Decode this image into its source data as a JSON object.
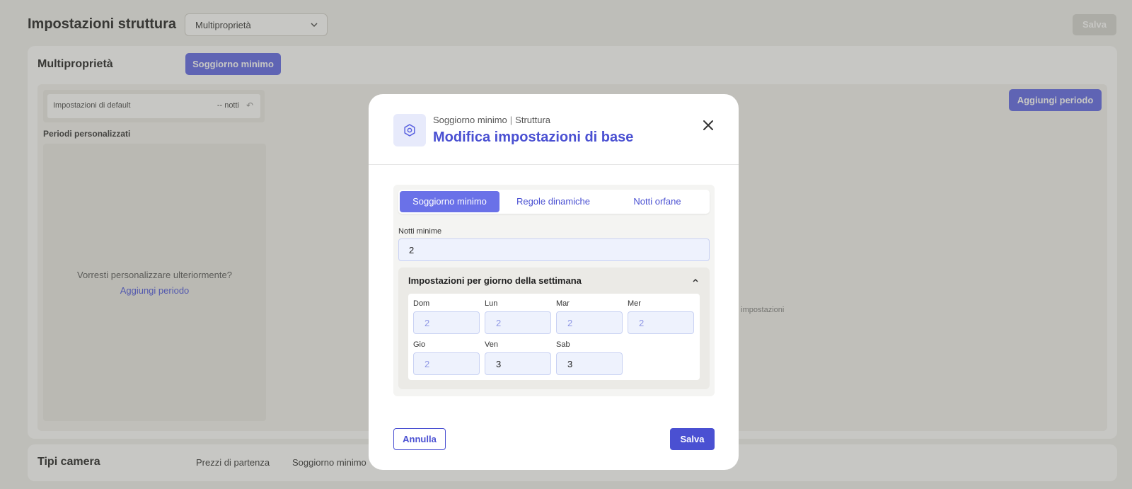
{
  "page": {
    "title": "Impostazioni struttura",
    "property_select_value": "Multiproprietà",
    "save_label": "Salva"
  },
  "main_card": {
    "title": "Multiproprietà",
    "tab_label": "Soggiorno minimo",
    "default_settings_label": "Impostazioni di default",
    "default_settings_value": "-- notti",
    "custom_periods_label": "Periodi personalizzati",
    "customize_question": "Vorresti personalizzare ulteriormente?",
    "add_period_link": "Aggiungi periodo",
    "add_period_button": "Aggiungi periodo",
    "hint_text": "e impostazioni"
  },
  "bottom_card": {
    "title": "Tipi camera",
    "tabs": [
      "Prezzi di partenza",
      "Soggiorno minimo"
    ]
  },
  "modal": {
    "breadcrumb_section": "Soggiorno minimo",
    "breadcrumb_separator": "|",
    "breadcrumb_scope": "Struttura",
    "title": "Modifica impostazioni di base",
    "tabs": [
      "Soggiorno minimo",
      "Regole dinamiche",
      "Notti orfane"
    ],
    "active_tab": "Soggiorno minimo",
    "min_nights_label": "Notti minime",
    "min_nights_value": "2",
    "weekday_section_title": "Impostazioni per giorno della settimana",
    "days": [
      {
        "label": "Dom",
        "value": "2",
        "inherited": true
      },
      {
        "label": "Lun",
        "value": "2",
        "inherited": true
      },
      {
        "label": "Mar",
        "value": "2",
        "inherited": true
      },
      {
        "label": "Mer",
        "value": "2",
        "inherited": true
      },
      {
        "label": "Gio",
        "value": "2",
        "inherited": true
      },
      {
        "label": "Ven",
        "value": "3",
        "inherited": false
      },
      {
        "label": "Sab",
        "value": "3",
        "inherited": false
      }
    ],
    "cancel_label": "Annulla",
    "save_label": "Salva"
  },
  "colors": {
    "accent": "#4a50d2",
    "accent_light": "#6a71e8",
    "input_bg": "#eef2fd"
  }
}
